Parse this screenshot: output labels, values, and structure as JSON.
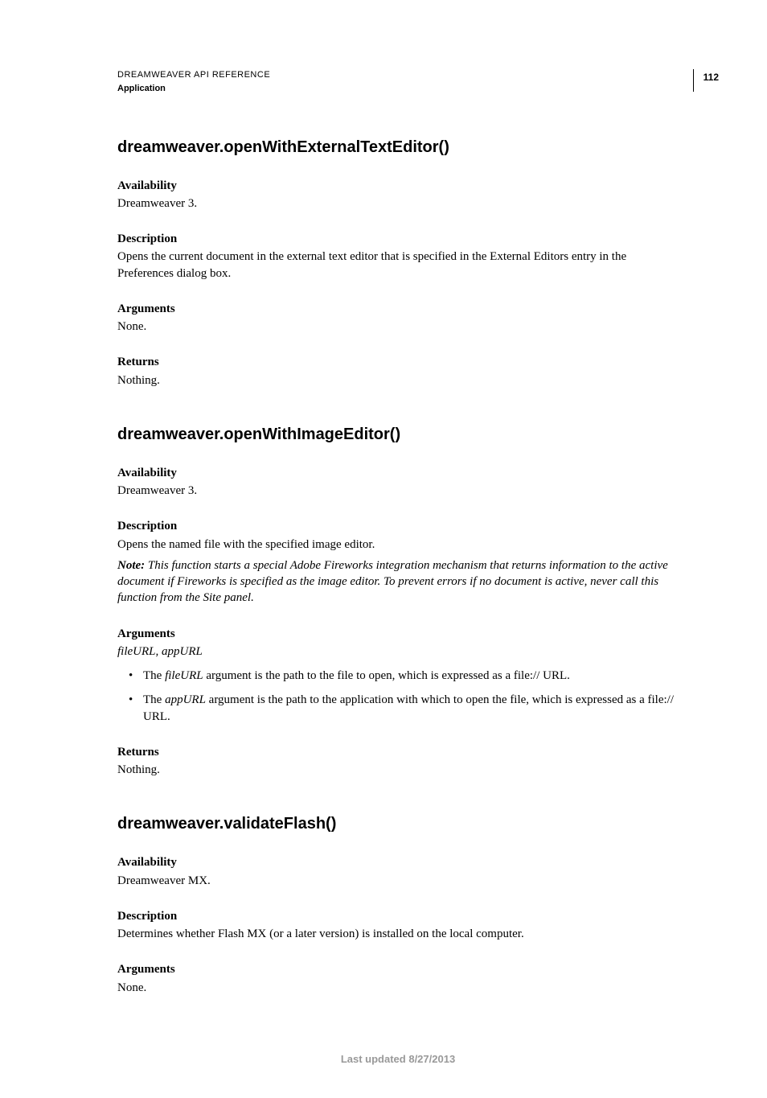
{
  "header": {
    "title": "DREAMWEAVER API REFERENCE",
    "section": "Application",
    "page_number": "112"
  },
  "fn1": {
    "title": "dreamweaver.openWithExternalTextEditor()",
    "availability_h": "Availability",
    "availability": "Dreamweaver 3.",
    "description_h": "Description",
    "description": "Opens the current document in the external text editor that is specified in the External Editors entry in the Preferences dialog box.",
    "arguments_h": "Arguments",
    "arguments": "None.",
    "returns_h": "Returns",
    "returns": "Nothing."
  },
  "fn2": {
    "title": "dreamweaver.openWithImageEditor()",
    "availability_h": "Availability",
    "availability": "Dreamweaver 3.",
    "description_h": "Description",
    "description": "Opens the named file with the specified image editor.",
    "note_label": "Note:",
    "note": " This function starts a special Adobe Fireworks integration mechanism that returns information to the active document if Fireworks is specified as the image editor. To prevent errors if no document is active, never call this function from the Site panel.",
    "arguments_h": "Arguments",
    "args_sig": "fileURL, appURL",
    "arg1_pre": "The ",
    "arg1_name": "fileURL",
    "arg1_post": " argument is the path to the file to open, which is expressed as a file:// URL.",
    "arg2_pre": "The ",
    "arg2_name": "appURL",
    "arg2_post": " argument is the path to the application with which to open the file, which is expressed as a file:// URL.",
    "returns_h": "Returns",
    "returns": "Nothing."
  },
  "fn3": {
    "title": "dreamweaver.validateFlash()",
    "availability_h": "Availability",
    "availability": "Dreamweaver MX.",
    "description_h": "Description",
    "description": "Determines whether Flash MX (or a later version) is installed on the local computer.",
    "arguments_h": "Arguments",
    "arguments": "None."
  },
  "footer": "Last updated 8/27/2013"
}
